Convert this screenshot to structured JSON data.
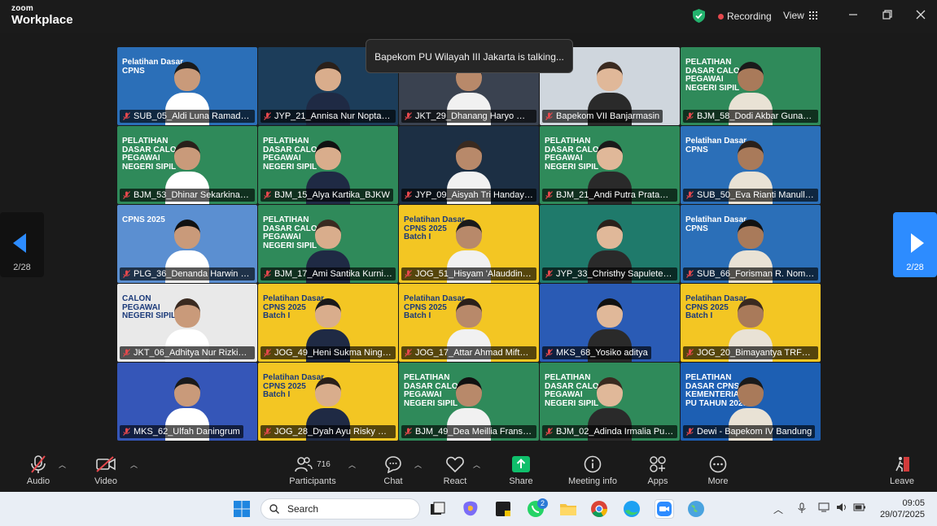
{
  "titlebar": {
    "brand_top": "zoom",
    "brand_bottom": "Workplace",
    "recording_label": "Recording",
    "view_label": "View",
    "icons": [
      "shield-check-icon",
      "minimize-icon",
      "restore-icon",
      "close-icon"
    ]
  },
  "talking_banner": "Bapekom PU Wilayah III Jakarta is talking...",
  "pager": {
    "left_label": "2/28",
    "right_label": "2/28"
  },
  "participants": [
    {
      "name": "SUB_05_Aldi Luna Ramadhan",
      "bg": "#2b6fb8",
      "banner": "Pelatihan Dasar CPNS"
    },
    {
      "name": "JYP_21_Annisa Nur Noptapi...",
      "bg": "#1c3d5a",
      "banner": ""
    },
    {
      "name": "JKT_29_Dhanang Haryo Wic...",
      "bg": "#3a4250",
      "banner": ""
    },
    {
      "name": "Bapekom VII Banjarmasin",
      "bg": "#cfd6dd",
      "banner": ""
    },
    {
      "name": "BJM_58_Dodi Akbar Gunawa...",
      "bg": "#2f8a5a",
      "banner": "PELATIHAN DASAR CALON PEGAWAI NEGERI SIPIL"
    },
    {
      "name": "BJM_53_Dhinar Sekarkinasih...",
      "bg": "#2f8a5a",
      "banner": "PELATIHAN DASAR CALON PEGAWAI NEGERI SIPIL"
    },
    {
      "name": "BJM_15_Alya Kartika_BJKW",
      "bg": "#2f8a5a",
      "banner": "PELATIHAN DASAR CALON PEGAWAI NEGERI SIPIL"
    },
    {
      "name": "JYP_09_Aisyah Tri Handayan...",
      "bg": "#1c2f44",
      "banner": ""
    },
    {
      "name": "BJM_21_Andi Putra Pratama...",
      "bg": "#2f8a5a",
      "banner": "PELATIHAN DASAR CALON PEGAWAI NEGERI SIPIL"
    },
    {
      "name": "SUB_50_Eva Rianti Manullan...",
      "bg": "#2b6fb8",
      "banner": "Pelatihan Dasar CPNS"
    },
    {
      "name": "PLG_36_Denanda Harwin Ro...",
      "bg": "#5b8fd1",
      "banner": "CPNS 2025"
    },
    {
      "name": "BJM_17_Ami Santika Kurniat...",
      "bg": "#2f8a5a",
      "banner": "PELATIHAN DASAR CALON PEGAWAI NEGERI SIPIL"
    },
    {
      "name": "JOG_51_Hisyam 'Alauddin_P...",
      "bg": "#f3c623",
      "banner": "Pelatihan Dasar CPNS 2025 Batch I"
    },
    {
      "name": "JYP_33_Christhy Sapulete_B...",
      "bg": "#1f7a6b",
      "banner": ""
    },
    {
      "name": "SUB_66_Forisman R. Nomna...",
      "bg": "#2b6fb8",
      "banner": "Pelatihan Dasar CPNS"
    },
    {
      "name": "JKT_06_Adhitya Nur Rizki_BP...",
      "bg": "#e9e9e9",
      "banner": "CALON PEGAWAI NEGERI SIPIL"
    },
    {
      "name": "JOG_49_Heni Sukma Ningru...",
      "bg": "#f3c623",
      "banner": "Pelatihan Dasar CPNS 2025 Batch I"
    },
    {
      "name": "JOG_17_Attar Ahmad Miftah...",
      "bg": "#f3c623",
      "banner": "Pelatihan Dasar CPNS 2025 Batch I"
    },
    {
      "name": "MKS_68_Yosiko aditya",
      "bg": "#2a5bb5",
      "banner": ""
    },
    {
      "name": "JOG_20_Bimayantya TRF_BP...",
      "bg": "#f3c623",
      "banner": "Pelatihan Dasar CPNS 2025 Batch I"
    },
    {
      "name": "MKS_62_Ulfah Daningrum",
      "bg": "#3556b8",
      "banner": ""
    },
    {
      "name": "JOG_28_Dyah Ayu Risky Har...",
      "bg": "#f3c623",
      "banner": "Pelatihan Dasar CPNS 2025 Batch I"
    },
    {
      "name": "BJM_49_Dea Meillia Fransisc...",
      "bg": "#2f8a5a",
      "banner": "PELATIHAN DASAR CALON PEGAWAI NEGERI SIPIL"
    },
    {
      "name": "BJM_02_Adinda Irmalia Putri...",
      "bg": "#2f8a5a",
      "banner": "PELATIHAN DASAR CALON PEGAWAI NEGERI SIPIL"
    },
    {
      "name": "Dewi - Bapekom IV Bandung",
      "bg": "#1d5fb3",
      "banner": "PELATIHAN DASAR CPNS KEMENTERIAN PU TAHUN 2025"
    }
  ],
  "toolbar": {
    "audio": "Audio",
    "video": "Video",
    "participants": "Participants",
    "participants_count": "716",
    "chat": "Chat",
    "react": "React",
    "share": "Share",
    "meeting_info": "Meeting info",
    "apps": "Apps",
    "more": "More",
    "leave": "Leave"
  },
  "taskbar": {
    "search_placeholder": "Search",
    "whatsapp_badge": "2",
    "time": "09:05",
    "date": "29/07/2025"
  },
  "colors": {
    "accent": "#2d8cff",
    "share_green": "#0fbf6b",
    "muted_red": "#e5484d"
  }
}
